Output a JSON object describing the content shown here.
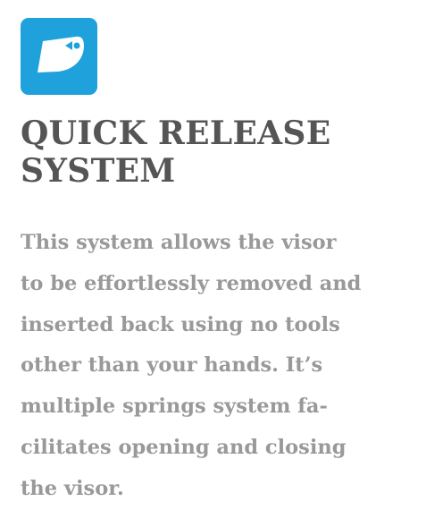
{
  "feature": {
    "icon": "visor-quick-release-icon",
    "accent_color": "#1fa2dc",
    "title_color": "#555555",
    "text_color": "#999999",
    "title_lines": [
      "QUICK RELEASE",
      "SYSTEM"
    ],
    "description_lines": [
      "This system allows the visor",
      "to be effortlessly removed and",
      "inserted back using no tools",
      "other than your hands. It’s",
      "multiple springs system fa-",
      "cilitates opening and closing",
      "the visor."
    ]
  }
}
